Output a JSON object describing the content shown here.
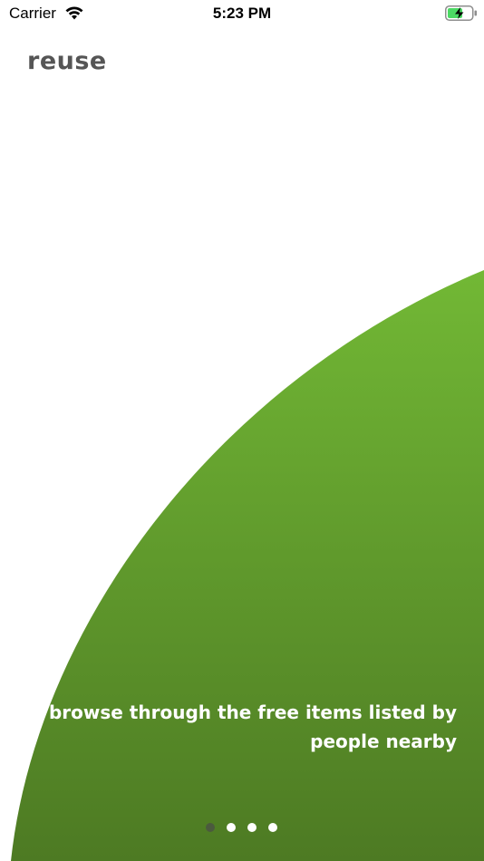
{
  "status_bar": {
    "carrier": "Carrier",
    "time": "5:23 PM",
    "battery_icon": "battery-charging-icon",
    "wifi_icon": "wifi-icon"
  },
  "brand": {
    "name": "reuse"
  },
  "onboarding": {
    "caption_line1": "browse through the free items listed by",
    "caption_line2": "people nearby",
    "page_count": 4,
    "current_page": 1
  },
  "colors": {
    "brand_text": "#555555",
    "green_top": "#72b835",
    "green_bottom": "#4d7a23",
    "dot_active": "#4b5a3e",
    "dot_inactive": "#ffffff"
  }
}
